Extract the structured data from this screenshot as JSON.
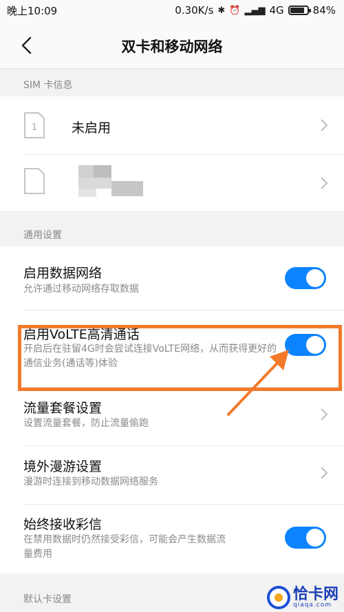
{
  "status_bar": {
    "time": "晚上10:09",
    "net_speed": "0.30K/s",
    "network": "4G",
    "battery": "84%",
    "battery_level": 0.84
  },
  "header": {
    "title": "双卡和移动网络"
  },
  "sim_section": {
    "label": "SIM 卡信息",
    "sims": [
      {
        "slot": "1",
        "name": "未启用"
      },
      {
        "slot": "",
        "name": ""
      }
    ]
  },
  "general_section": {
    "label": "通用设置",
    "items": [
      {
        "title": "启用数据网络",
        "subtitle": "允许通过移动网络存取数据",
        "control": "toggle",
        "on": true
      },
      {
        "title": "启用VoLTE高清通话",
        "subtitle": "开启后在驻留4G时会尝试连接VoLTE网络，从而获得更好的通信业务(通话等)体验",
        "control": "toggle",
        "on": true
      },
      {
        "title": "流量套餐设置",
        "subtitle": "设置流量套餐，防止流量偷跑",
        "control": "chevron"
      },
      {
        "title": "境外漫游设置",
        "subtitle": "漫游时连接到移动数据网络服务",
        "control": "chevron"
      },
      {
        "title": "始终接收彩信",
        "subtitle": "在禁用数据时仍然接受彩信，可能会产生数据流量费用",
        "control": "toggle",
        "on": true
      }
    ]
  },
  "default_section": {
    "label": "默认卡设置"
  },
  "watermark": {
    "name": "恰卡网",
    "domain": "qiaqa.com"
  },
  "colors": {
    "accent": "#0d84ff",
    "highlight": "#f27a2a"
  }
}
